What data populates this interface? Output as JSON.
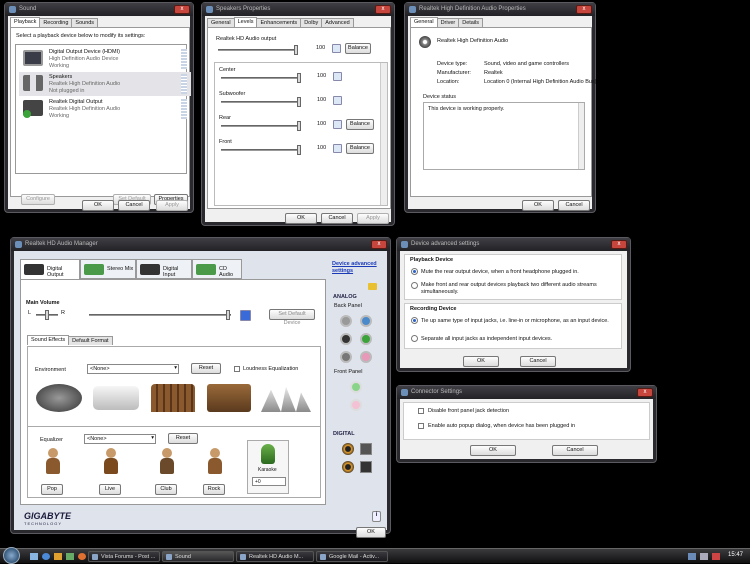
{
  "sound": {
    "title": "Sound",
    "tabs": [
      "Playback",
      "Recording",
      "Sounds"
    ],
    "instruction": "Select a playback device below to modify its settings:",
    "devices": [
      {
        "name": "Digital Output Device (HDMI)",
        "desc": "High Definition Audio Device",
        "status": "Working"
      },
      {
        "name": "Speakers",
        "desc": "Realtek High Definition Audio",
        "status": "Not plugged in"
      },
      {
        "name": "Realtek Digital Output",
        "desc": "Realtek High Definition Audio",
        "status": "Working"
      }
    ],
    "configure": "Configure",
    "set_default": "Set Default",
    "properties": "Properties",
    "ok": "OK",
    "cancel": "Cancel",
    "apply": "Apply"
  },
  "speakers": {
    "title": "Speakers Properties",
    "tabs": [
      "General",
      "Levels",
      "Enhancements",
      "Dolby",
      "Advanced"
    ],
    "main_label": "Realtek HD Audio output",
    "main_value": "100",
    "main_level": 1.0,
    "balance": "Balance",
    "channels": [
      {
        "label": "Center",
        "value": "100",
        "balance": false
      },
      {
        "label": "Subwoofer",
        "value": "100",
        "balance": false
      },
      {
        "label": "Rear",
        "value": "100",
        "balance": true
      },
      {
        "label": "Front",
        "value": "100",
        "balance": true
      }
    ],
    "ok": "OK",
    "cancel": "Cancel",
    "apply": "Apply"
  },
  "realtek_props": {
    "title": "Realtek High Definition Audio Properties",
    "tabs": [
      "General",
      "Driver",
      "Details"
    ],
    "device_name": "Realtek High Definition Audio",
    "rows": [
      {
        "k": "Device type:",
        "v": "Sound, video and game controllers"
      },
      {
        "k": "Manufacturer:",
        "v": "Realtek"
      },
      {
        "k": "Location:",
        "v": "Location 0 (Internal High Definition Audio Bus)"
      }
    ],
    "status_label": "Device status",
    "status_text": "This device is working properly.",
    "ok": "OK",
    "cancel": "Cancel"
  },
  "hdam": {
    "title": "Realtek HD Audio Manager",
    "tabs": [
      "Digital Output",
      "Stereo Mix",
      "Digital Input",
      "CD Audio"
    ],
    "adv_link": "Device advanced settings",
    "main_volume": "Main Volume",
    "left": "L",
    "right": "R",
    "volume_level": 0.97,
    "set_default": "Set Default Device",
    "subtabs": [
      "Sound Effects",
      "Default Format"
    ],
    "environment": "Environment",
    "env_value": "<None>",
    "reset": "Reset",
    "loudness": "Loudness Equalization",
    "equalizer": "Equalizer",
    "eq_value": "<None>",
    "presets": [
      "Pop",
      "Live",
      "Club",
      "Rock"
    ],
    "karaoke": "Karaoke",
    "karaoke_value": "+0",
    "analog": "ANALOG",
    "back_panel": "Back Panel",
    "front_panel": "Front Panel",
    "digital": "DIGITAL",
    "brand": "GIGABYTE",
    "brand_sub": "TECHNOLOGY",
    "info": "i",
    "ok": "OK"
  },
  "dev_adv": {
    "title": "Device advanced settings",
    "playback_head": "Playback Device",
    "pb_opt1": "Mute the rear output device, when a front headphone plugged in.",
    "pb_opt2a": "Make front and rear output devices playback two different audio streams",
    "pb_opt2b": "simultaneously.",
    "rec_head": "Recording Device",
    "rec_opt1": "Tie up same type of input jacks, i.e. line-in or microphone, as an input device.",
    "rec_opt2": "Separate all input jacks as independent input devices.",
    "ok": "OK",
    "cancel": "Cancel"
  },
  "conn": {
    "title": "Connector Settings",
    "opt1": "Disable front panel jack detection",
    "opt2": "Enable auto popup dialog, when device has been plugged in",
    "ok": "OK",
    "cancel": "Cancel"
  },
  "taskbar": {
    "items": [
      "Vista Forums - Post ...",
      "Sound",
      "Realtek HD Audio M...",
      "Google Mail - Activ..."
    ],
    "clock": "15:47"
  }
}
